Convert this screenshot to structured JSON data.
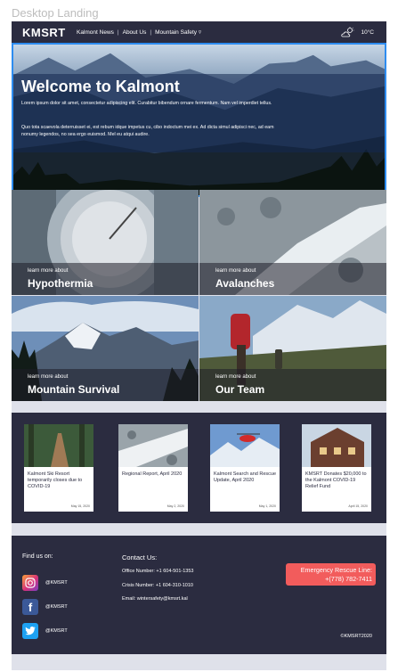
{
  "frame_label": "Desktop Landing",
  "nav": {
    "logo": "KMSRT",
    "links": [
      "Kalmont News",
      "About Us",
      "Mountain Safety ▿"
    ],
    "separators": [
      "|",
      "|"
    ],
    "temperature": "10°C",
    "weather_icon": "partly-cloudy-icon"
  },
  "hero": {
    "title": "Welcome to Kalmont",
    "paragraph1": "Lorem ipsum dolor sit amet, consectetur adipiscing elit. Curabitur bibendum ornare fermentum. Nam vel imperdiet tellus.",
    "paragraph2": "Quo tota scaevola deterruisset ei, est rebum idque impetus cu, cibo indoctum mei ex. Ad dicta simul adipisci nec, ad eam nonumy legendos, no sea ergo euismod. Mel eu atqui audire."
  },
  "tiles": [
    {
      "small": "learn more about",
      "big": "Hypothermia"
    },
    {
      "small": "learn more about",
      "big": "Avalanches"
    },
    {
      "small": "learn more about",
      "big": "Mountain Survival"
    },
    {
      "small": "learn more about",
      "big": "Our Team"
    }
  ],
  "news": [
    {
      "title": "Kalmont Ski Resort temporarily closes due to COVID-19",
      "date": "May 15, 2020"
    },
    {
      "title": "Regional Report, April 2020",
      "date": "May 2, 2020"
    },
    {
      "title": "Kalmont Search and Rescue Update, April 2020",
      "date": "May 1, 2020"
    },
    {
      "title": "KMSRT Donates $20,000 to the Kalmont COVID-19 Relief Fund",
      "date": "April 15, 2020"
    }
  ],
  "footer": {
    "find_us": "Find us on:",
    "socials": [
      {
        "icon": "instagram-icon",
        "handle": "@KMSRT",
        "color": "#d6317b"
      },
      {
        "icon": "facebook-icon",
        "handle": "@KMSRT",
        "color": "#3b5998"
      },
      {
        "icon": "twitter-icon",
        "handle": "@KMSRT",
        "color": "#1da1f2"
      }
    ],
    "contact_title": "Contact Us:",
    "office": "Office Number: +1 604-501-1353",
    "crisis": "Crisis Number: +1 604-310-1010",
    "email": "Email: wintersafety@kmsrt.kal",
    "emergency_label": "Emergency Rescue Line:",
    "emergency_number": "+(778) 782-7411",
    "copyright": "©KMSRT2020"
  },
  "colors": {
    "navy": "#2b2c40",
    "accent_red": "#f25c5c",
    "selection_blue": "#2d8cf0",
    "artboard_bg": "#dfe1ea"
  }
}
